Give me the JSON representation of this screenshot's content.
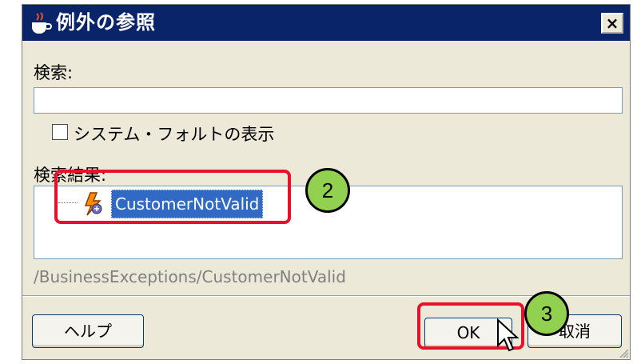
{
  "dialog": {
    "title": "例外の参照",
    "close_label": "×",
    "search_label": "検索:",
    "search_value": "",
    "checkbox_label": "システム・フォルトの表示",
    "checkbox_checked": false,
    "results_label": "検索結果:",
    "results": [
      {
        "label": "CustomerNotValid",
        "selected": true
      }
    ],
    "selected_path": "/BusinessExceptions/CustomerNotValid",
    "help_label": "ヘルプ",
    "ok_label": "OK",
    "cancel_label": "取消"
  },
  "annotations": {
    "step_2": "2",
    "step_3": "3"
  },
  "colors": {
    "titlebar": "#0a246a",
    "selection": "#316ac5",
    "highlight": "#e8102a",
    "badge": "#92d050"
  }
}
